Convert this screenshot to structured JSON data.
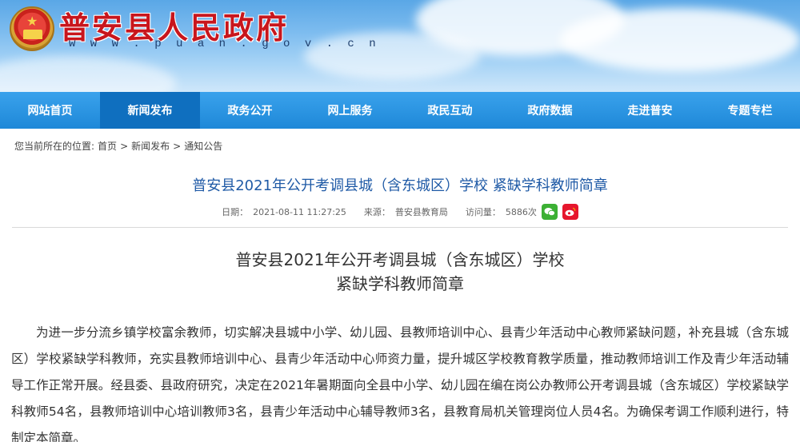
{
  "header": {
    "site_title": "普安县人民政府",
    "site_url": "w w w . p u a n . g o v . c n"
  },
  "nav": {
    "items": [
      {
        "label": "网站首页"
      },
      {
        "label": "新闻发布"
      },
      {
        "label": "政务公开"
      },
      {
        "label": "网上服务"
      },
      {
        "label": "政民互动"
      },
      {
        "label": "政府数据"
      },
      {
        "label": "走进普安"
      },
      {
        "label": "专题专栏"
      }
    ],
    "active_index": 1
  },
  "breadcrumb": {
    "prefix": "您当前所在的位置:",
    "items": [
      "首页",
      "新闻发布",
      "通知公告"
    ],
    "separator": ">"
  },
  "article": {
    "title": "普安县2021年公开考调县城（含东城区）学校 紧缺学科教师简章",
    "date_label": "日期：",
    "date": "2021-08-11 11:27:25",
    "source_label": "来源：",
    "source": "普安县教育局",
    "views_label": "访问量：",
    "views": "5886次",
    "share_icons": [
      "wechat-icon",
      "weibo-icon"
    ],
    "body_title_line1": "普安县2021年公开考调县城（含东城区）学校",
    "body_title_line2": "紧缺学科教师简章",
    "paragraph": "为进一步分流乡镇学校富余教师，切实解决县城中小学、幼儿园、县教师培训中心、县青少年活动中心教师紧缺问题，补充县城（含东城区）学校紧缺学科教师，充实县教师培训中心、县青少年活动中心师资力量，提升城区学校教育教学质量，推动教师培训工作及青少年活动辅导工作正常开展。经县委、县政府研究，决定在2021年暑期面向全县中小学、幼儿园在编在岗公办教师公开考调县城（含东城区）学校紧缺学科教师54名，县教师培训中心培训教师3名，县青少年活动中心辅导教师3名，县教育局机关管理岗位人员4名。为确保考调工作顺利进行，特制定本简章。"
  },
  "colors": {
    "nav_bg": "#1e88d8",
    "nav_active": "#0f6fbf",
    "title_red": "#c8161d",
    "article_title_blue": "#1f5aa6"
  }
}
